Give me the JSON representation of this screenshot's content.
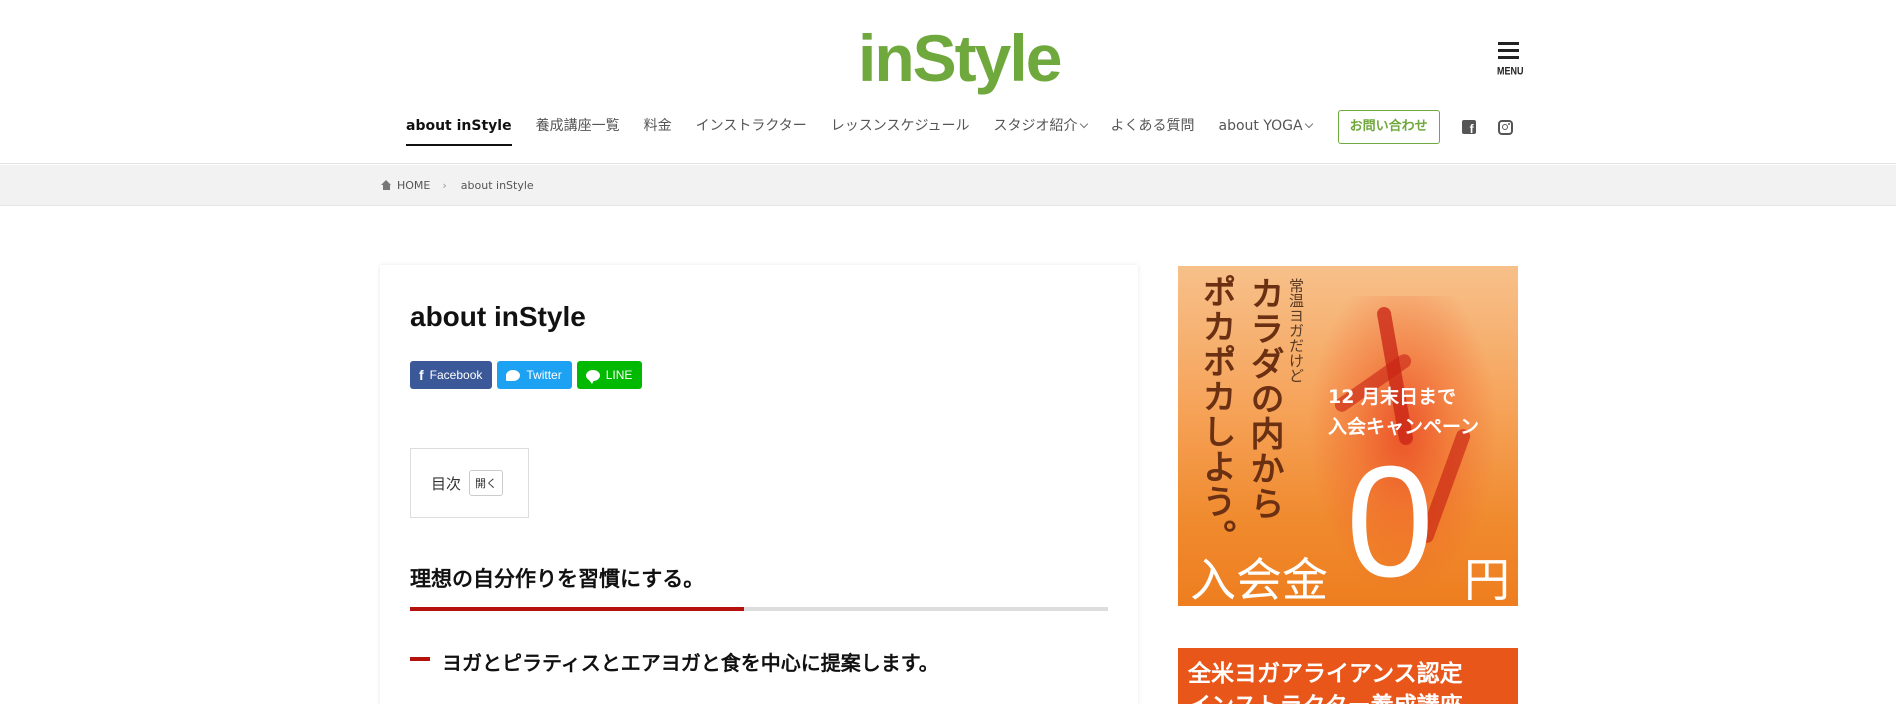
{
  "site": {
    "logo": "inStyle",
    "menu_label": "MENU"
  },
  "nav": {
    "items": [
      {
        "label": "about inStyle"
      },
      {
        "label": "養成講座一覧"
      },
      {
        "label": "料金"
      },
      {
        "label": "インストラクター"
      },
      {
        "label": "レッスンスケジュール"
      },
      {
        "label": "スタジオ紹介"
      },
      {
        "label": "よくある質問"
      },
      {
        "label": "about YOGA"
      }
    ],
    "contact_label": "お問い合わせ"
  },
  "breadcrumb": {
    "home": "HOME",
    "current": "about inStyle"
  },
  "article": {
    "title": "about inStyle",
    "share": {
      "facebook": "Facebook",
      "twitter": "Twitter",
      "line": "LINE"
    },
    "toc": {
      "label": "目次",
      "toggle": "開く"
    },
    "heading2": "理想の自分作りを習慣にする。",
    "heading3": "ヨガとピラティスとエアヨガと食を中心に提案します。"
  },
  "banner1": {
    "vertical_small": "常温ヨガだけど",
    "vertical_big1": "カラダの内から",
    "vertical_big2": "ポカポカしよう。",
    "campaign_line1": "12 月末日まで",
    "campaign_line2": "入会キャンペーン",
    "fee_label": "入会金",
    "fee_value": "0",
    "fee_unit": "円"
  },
  "banner2": {
    "line1": "全米ヨガアライアンス認定",
    "line2": "インストラクター養成講座"
  },
  "colors": {
    "brand_green": "#6fa83c",
    "accent_red": "#b5120e",
    "banner_orange": "#e8561a"
  }
}
